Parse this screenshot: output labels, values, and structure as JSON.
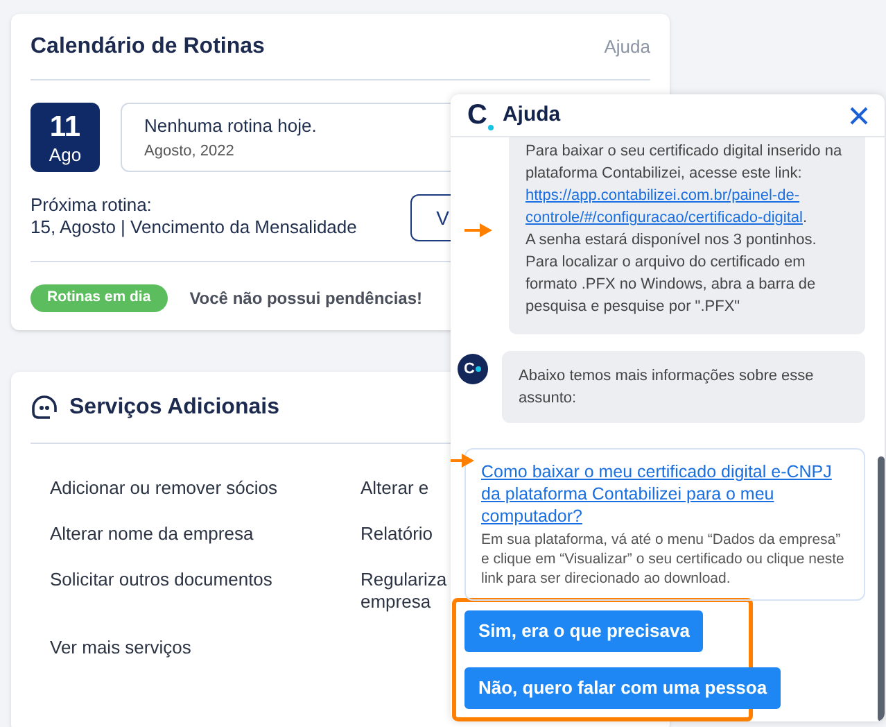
{
  "routines_card": {
    "title": "Calendário de Rotinas",
    "help_link": "Ajuda",
    "date": {
      "day": "11",
      "month": "Ago"
    },
    "today": {
      "message": "Nenhuma rotina hoje.",
      "period": "Agosto, 2022"
    },
    "next": {
      "label": "Próxima rotina:",
      "value": "15, Agosto | Vencimento da Mensalidade"
    },
    "button": "V",
    "status_badge": "Rotinas em dia",
    "status_message": "Você não possui pendências!"
  },
  "services_card": {
    "title": "Serviços Adicionais",
    "items": [
      {
        "label": "Adicionar ou remover sócios"
      },
      {
        "label": "Alterar e"
      },
      {
        "label": "Alterar nome da empresa"
      },
      {
        "label": "Relatório"
      },
      {
        "label": "Solicitar outros documentos"
      },
      {
        "label": "Regulariza empresa"
      },
      {
        "label": "Ver mais serviços"
      }
    ]
  },
  "help_panel": {
    "logo": "C",
    "title": "Ajuda",
    "answer": {
      "intro": "Para baixar o seu certificado digital inserido na plataforma Contabilizei, acesse este link:",
      "link_lines": [
        "https://app.contabilizei.com.br/painel-de-",
        "controle/#/configuracao/certificado-digital"
      ],
      "link_suffix": ".",
      "lines": [
        "A senha estará disponível nos 3 pontinhos.",
        "Para localizar o arquivo do certificado em formato .PFX no Windows, abra a barra de pesquisa e pesquise por \".PFX\""
      ]
    },
    "follow_up": {
      "avatar_logo": "C",
      "text": "Abaixo temos mais informações sobre esse assunto:"
    },
    "article": {
      "title": "Como baixar o meu certificado digital e-CNPJ da plataforma Contabilizei para o meu computador?",
      "description": "Em sua plataforma, vá até o menu “Dados da empresa” e clique em “Visualizar” o seu certificado ou clique neste link para ser direcionado ao download."
    },
    "buttons": [
      "Sim, era o que precisava",
      "Não, quero falar com uma pessoa"
    ]
  }
}
